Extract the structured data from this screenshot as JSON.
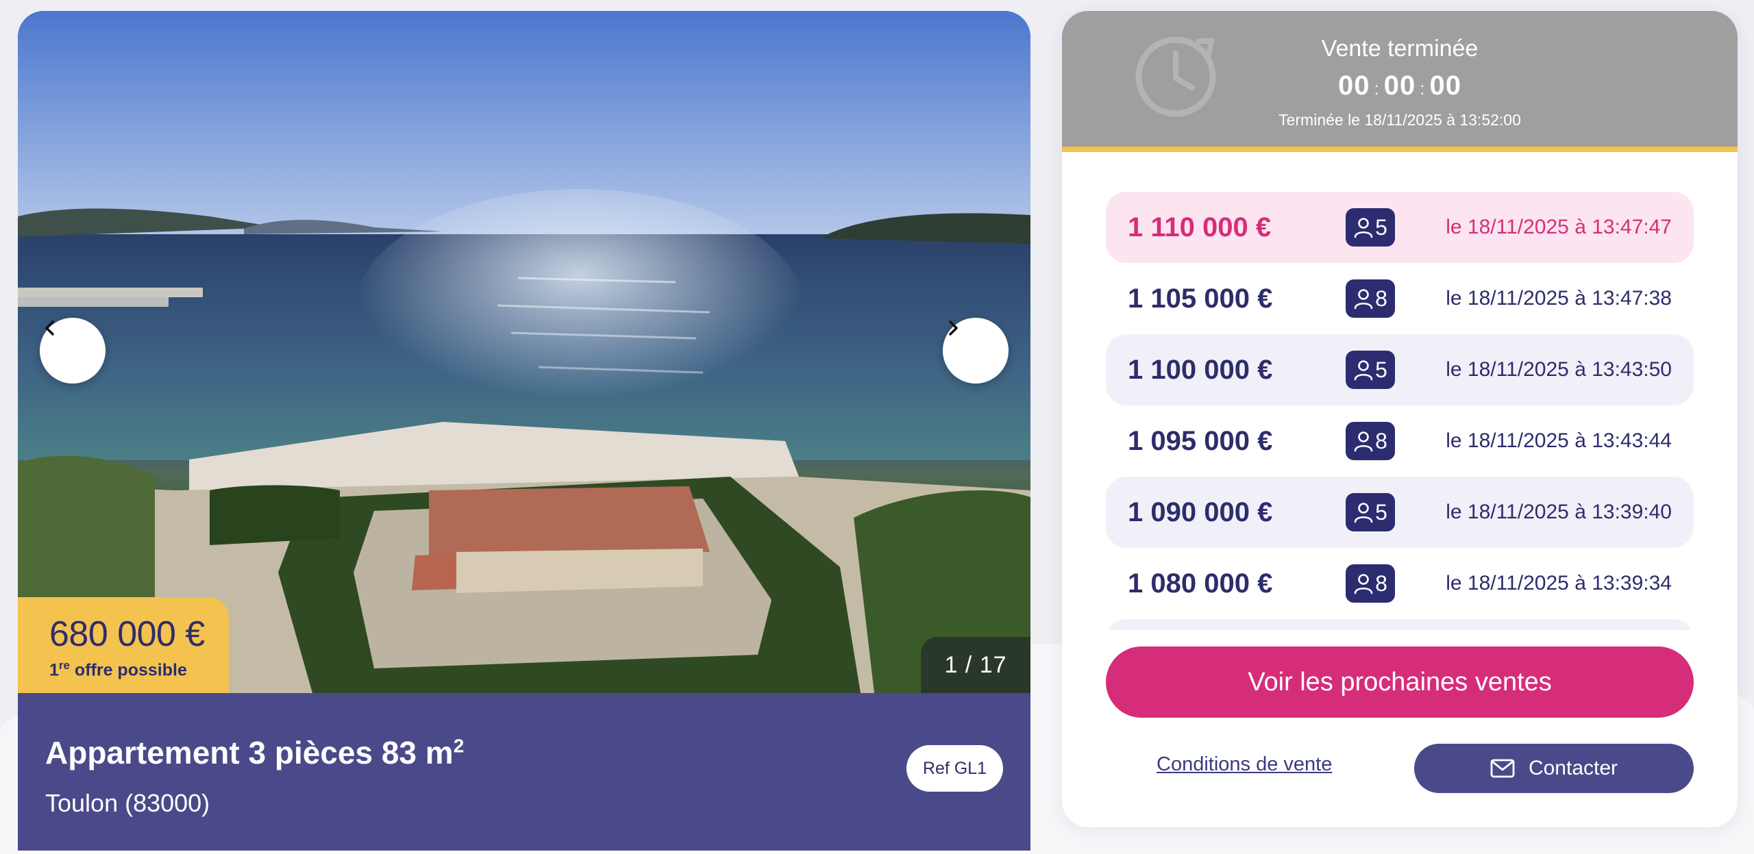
{
  "listing": {
    "photo_counter": "1 / 17",
    "price": "680 000 €",
    "offer_note_prefix": "1",
    "offer_note_sup": "re",
    "offer_note_suffix": " offre possible",
    "title": "Appartement 3 pièces 83 m",
    "title_sup": "2",
    "city": "Toulon (83000)",
    "ref": "Ref GL1",
    "prev_icon": "chevron-left-icon",
    "next_icon": "chevron-right-icon"
  },
  "auction": {
    "status": "Vente terminée",
    "timer": {
      "hours": "00",
      "minutes": "00",
      "seconds": "00",
      "separator": ":"
    },
    "ended_at": "Terminée le 18/11/2025 à 13:52:00",
    "bids": [
      {
        "amount": "1 110 000 €",
        "bidder": "5",
        "when": "le 18/11/2025 à 13:47:47"
      },
      {
        "amount": "1 105 000 €",
        "bidder": "8",
        "when": "le 18/11/2025 à 13:47:38"
      },
      {
        "amount": "1 100 000 €",
        "bidder": "5",
        "when": "le 18/11/2025 à 13:43:50"
      },
      {
        "amount": "1 095 000 €",
        "bidder": "8",
        "when": "le 18/11/2025 à 13:43:44"
      },
      {
        "amount": "1 090 000 €",
        "bidder": "5",
        "when": "le 18/11/2025 à 13:39:40"
      },
      {
        "amount": "1 080 000 €",
        "bidder": "8",
        "when": "le 18/11/2025 à 13:39:34"
      }
    ],
    "cta_label": "Voir les prochaines ventes",
    "conditions_label": "Conditions de vente",
    "contact_label": "Contacter"
  },
  "colors": {
    "brand_navy": "#4a4a8a",
    "brand_pink": "#d62d7a",
    "accent_yellow": "#f4c24f",
    "ended_grey": "#9e9f9e"
  }
}
